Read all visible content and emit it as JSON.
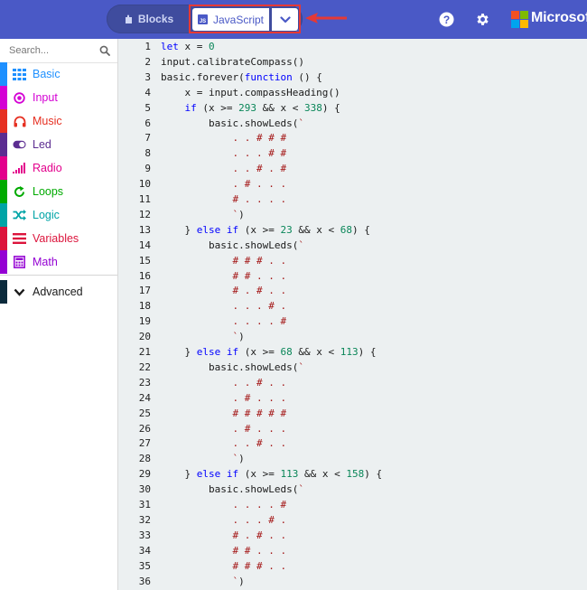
{
  "topbar": {
    "mode_blocks_label": "Blocks",
    "mode_js_label": "JavaScript",
    "brand": "Microsoft",
    "background_color": "#4a59c6",
    "highlight_color": "#e53935"
  },
  "sidebar": {
    "search_placeholder": "Search...",
    "categories": [
      {
        "label": "Basic",
        "icon": "grid-icon",
        "color": "#1e90ff"
      },
      {
        "label": "Input",
        "icon": "circle-target-icon",
        "color": "#d400d4"
      },
      {
        "label": "Music",
        "icon": "headphones-icon",
        "color": "#e63022"
      },
      {
        "label": "Led",
        "icon": "toggle-icon",
        "color": "#5c2d91"
      },
      {
        "label": "Radio",
        "icon": "signal-bars-icon",
        "color": "#e3008c"
      },
      {
        "label": "Loops",
        "icon": "refresh-icon",
        "color": "#00aa00"
      },
      {
        "label": "Logic",
        "icon": "shuffle-icon",
        "color": "#00a4a6"
      },
      {
        "label": "Variables",
        "icon": "lines-icon",
        "color": "#dc143c"
      },
      {
        "label": "Math",
        "icon": "calculator-icon",
        "color": "#9400d3"
      }
    ],
    "advanced": {
      "label": "Advanced",
      "color": "#1a1a1a",
      "stripe": "#0b2a3c"
    }
  },
  "editor": {
    "line_numbers": [
      "1",
      "2",
      "3",
      "4",
      "5",
      "6",
      "7",
      "8",
      "9",
      "10",
      "11",
      "12",
      "13",
      "14",
      "15",
      "16",
      "17",
      "18",
      "19",
      "20",
      "21",
      "22",
      "23",
      "24",
      "25",
      "26",
      "27",
      "28",
      "29",
      "30",
      "31",
      "32",
      "33",
      "34",
      "35",
      "36"
    ],
    "lines": [
      "let x = 0",
      "input.calibrateCompass()",
      "basic.forever(function () {",
      "    x = input.compassHeading()",
      "    if (x >= 293 && x < 338) {",
      "        basic.showLeds(`",
      "            . . # # #",
      "            . . . # #",
      "            . . # . #",
      "            . # . . .",
      "            # . . . .",
      "            `)",
      "    } else if (x >= 23 && x < 68) {",
      "        basic.showLeds(`",
      "            # # # . .",
      "            # # . . .",
      "            # . # . .",
      "            . . . # .",
      "            . . . . #",
      "            `)",
      "    } else if (x >= 68 && x < 113) {",
      "        basic.showLeds(`",
      "            . . # . .",
      "            . # . . .",
      "            # # # # #",
      "            . # . . .",
      "            . . # . .",
      "            `)",
      "    } else if (x >= 113 && x < 158) {",
      "        basic.showLeds(`",
      "            . . . . #",
      "            . . . # .",
      "            # . # . .",
      "            # # . . .",
      "            # # # . .",
      "            `)"
    ]
  }
}
